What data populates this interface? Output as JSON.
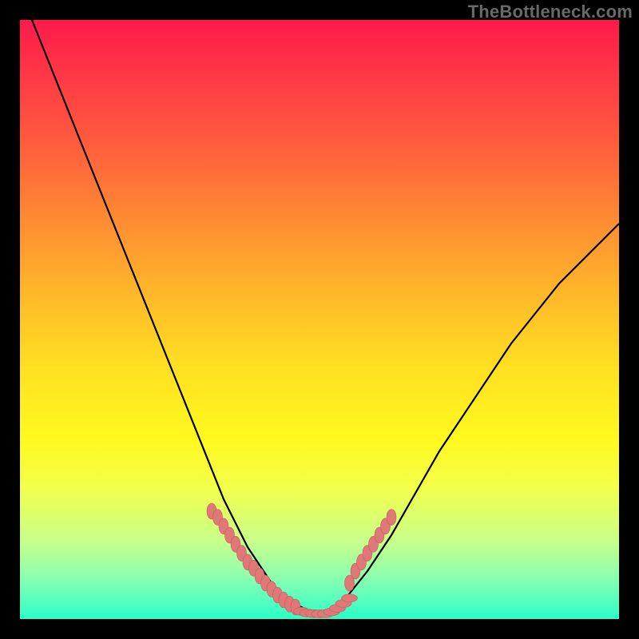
{
  "watermark": "TheBottleneck.com",
  "colors": {
    "curve_stroke": "#000000",
    "marker_fill": "#e07878",
    "marker_stroke": "#c05a5a",
    "frame": "#000000"
  },
  "chart_data": {
    "type": "line",
    "title": "",
    "xlabel": "",
    "ylabel": "",
    "xlim": [
      0,
      100
    ],
    "ylim": [
      0,
      100
    ],
    "curve": {
      "x": [
        2,
        6,
        10,
        14,
        18,
        22,
        26,
        30,
        32,
        34,
        36,
        38,
        40,
        42,
        44,
        46,
        48,
        50,
        52,
        54,
        58,
        62,
        66,
        70,
        74,
        78,
        82,
        86,
        90,
        94,
        98,
        100
      ],
      "y": [
        100,
        90,
        80,
        70,
        60,
        50,
        40,
        30,
        25,
        20,
        16,
        12,
        9,
        6,
        4,
        2.5,
        1.5,
        1,
        1.5,
        3,
        8,
        14,
        21,
        28,
        34,
        40,
        46,
        51,
        56,
        60,
        64,
        66
      ]
    },
    "left_cluster": {
      "x": [
        32,
        33,
        34,
        35,
        36,
        37,
        38,
        39,
        40,
        41,
        42,
        43,
        44,
        45,
        46
      ],
      "y": [
        18,
        17,
        15.5,
        14,
        12.5,
        11,
        9.5,
        8.5,
        7.2,
        6.0,
        5.0,
        4.0,
        3.2,
        2.5,
        2.0
      ]
    },
    "trough_cluster": {
      "x": [
        47,
        48,
        49,
        50,
        51,
        52,
        53,
        54,
        55
      ],
      "y": [
        1.3,
        1.0,
        0.9,
        0.85,
        0.9,
        1.2,
        1.8,
        2.6,
        3.5
      ]
    },
    "right_cluster": {
      "x": [
        55,
        56,
        57,
        58,
        59,
        60,
        61,
        62
      ],
      "y": [
        6,
        8,
        9.5,
        11,
        12.5,
        14,
        15.5,
        17
      ]
    }
  }
}
